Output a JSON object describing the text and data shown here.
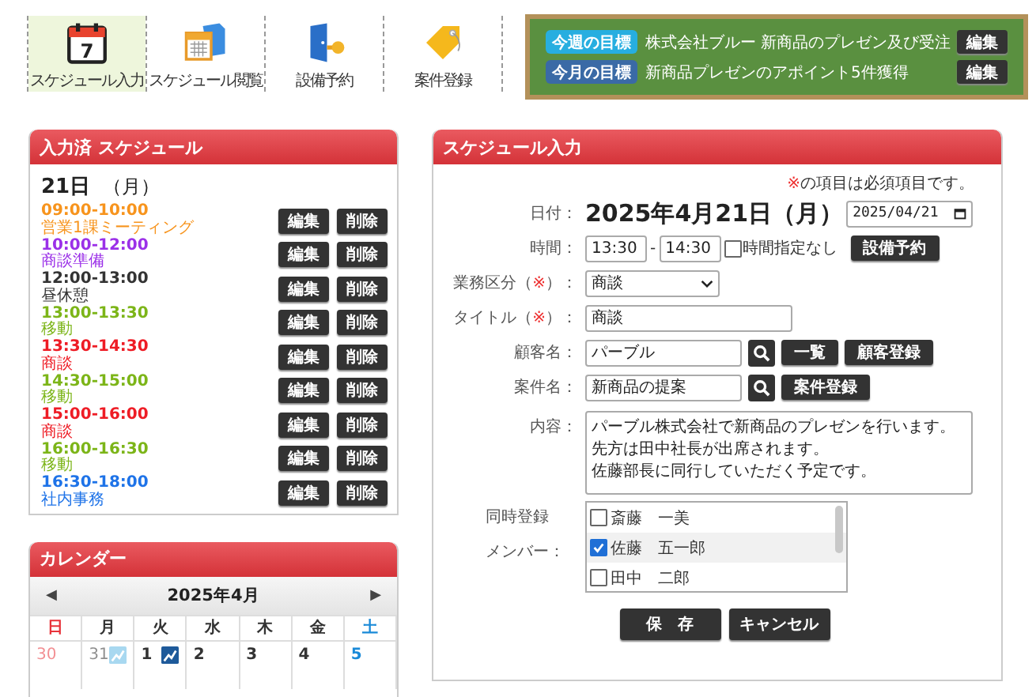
{
  "nav": [
    {
      "label": "スケジュール入力",
      "kind": "calendar",
      "icon_text": "7",
      "selected": true
    },
    {
      "label": "スケジュール閲覧",
      "kind": "calendar-folder",
      "selected": false
    },
    {
      "label": "設備予約",
      "kind": "door-key",
      "selected": false
    },
    {
      "label": "案件登録",
      "kind": "tag",
      "selected": false
    }
  ],
  "goals": [
    {
      "label": "今週の目標",
      "text": "株式会社ブルー 新商品のプレゼン及び受注",
      "color": "#27aee0",
      "button": "編集"
    },
    {
      "label": "今月の目標",
      "text": "新商品プレゼンのアポイント5件獲得",
      "color": "#3a6aa6",
      "button": "編集"
    }
  ],
  "schedule_panel": {
    "title": "入力済 スケジュール",
    "day": "21日",
    "weekday": "（月）",
    "items": [
      {
        "time": "09:00-10:00",
        "label": "営業1課ミーティング",
        "color": "#f7941d",
        "edit": "編集",
        "delete": "削除"
      },
      {
        "time": "10:00-12:00",
        "label": "商談準備",
        "color": "#9b30e8",
        "edit": "編集",
        "delete": "削除"
      },
      {
        "time": "12:00-13:00",
        "label": "昼休憩",
        "color": "#333333",
        "edit": "編集",
        "delete": "削除"
      },
      {
        "time": "13:00-13:30",
        "label": "移動",
        "color": "#7cb518",
        "edit": "編集",
        "delete": "削除"
      },
      {
        "time": "13:30-14:30",
        "label": "商談",
        "color": "#ee1c25",
        "edit": "編集",
        "delete": "削除"
      },
      {
        "time": "14:30-15:00",
        "label": "移動",
        "color": "#7cb518",
        "edit": "編集",
        "delete": "削除"
      },
      {
        "time": "15:00-16:00",
        "label": "商談",
        "color": "#ee1c25",
        "edit": "編集",
        "delete": "削除"
      },
      {
        "time": "16:00-16:30",
        "label": "移動",
        "color": "#7cb518",
        "edit": "編集",
        "delete": "削除"
      },
      {
        "time": "16:30-18:00",
        "label": "社内事務",
        "color": "#1e73e8",
        "edit": "編集",
        "delete": "削除"
      }
    ]
  },
  "calendar": {
    "title": "カレンダー",
    "prev": "◀",
    "month": "2025年4月",
    "next": "▶",
    "weekdays": [
      "日",
      "月",
      "火",
      "水",
      "木",
      "金",
      "土"
    ],
    "days": [
      {
        "label": "30",
        "other_month": true,
        "marked": false
      },
      {
        "label": "31",
        "other_month": true,
        "marked": true
      },
      {
        "label": "1",
        "other_month": false,
        "marked": true
      },
      {
        "label": "2",
        "other_month": false,
        "marked": false
      },
      {
        "label": "3",
        "other_month": false,
        "marked": false
      },
      {
        "label": "4",
        "other_month": false,
        "marked": false
      },
      {
        "label": "5",
        "other_month": false,
        "marked": false
      }
    ]
  },
  "form": {
    "title": "スケジュール入力",
    "note_mark": "※",
    "note": "の項目は必須項目です。",
    "date_label": "日付：",
    "date_text": "2025年4月21日（月）",
    "date_value": "2025/04/21",
    "time_label": "時間：",
    "time_start": "13:30",
    "time_sep": "-",
    "time_end": "14:30",
    "no_time": {
      "label": "時間指定なし",
      "checked": false
    },
    "facility_button": "設備予約",
    "category": {
      "label": "業務区分（",
      "mark": "※",
      "label_tail": "）：",
      "value": "商談"
    },
    "title_field": {
      "label": "タイトル（",
      "mark": "※",
      "label_tail": "）：",
      "value": "商談"
    },
    "customer": {
      "label": "顧客名：",
      "value": "パーブル",
      "buttons": [
        "一覧",
        "顧客登録"
      ]
    },
    "case": {
      "label": "案件名：",
      "value": "新商品の提案",
      "buttons": [
        "案件登録"
      ]
    },
    "content_label": "内容：",
    "content": [
      "パーブル株式会社で新商品のプレゼンを行います。",
      "先方は田中社長が出席されます。",
      "佐藤部長に同行していただく予定です。"
    ],
    "members_label": [
      "同時登録",
      "メンバー："
    ],
    "members": [
      {
        "name": "斎藤　一美",
        "checked": false
      },
      {
        "name": "佐藤　五一郎",
        "checked": true
      },
      {
        "name": "田中　二郎",
        "checked": false
      }
    ],
    "save": "保　存",
    "cancel": "キャンセル"
  }
}
